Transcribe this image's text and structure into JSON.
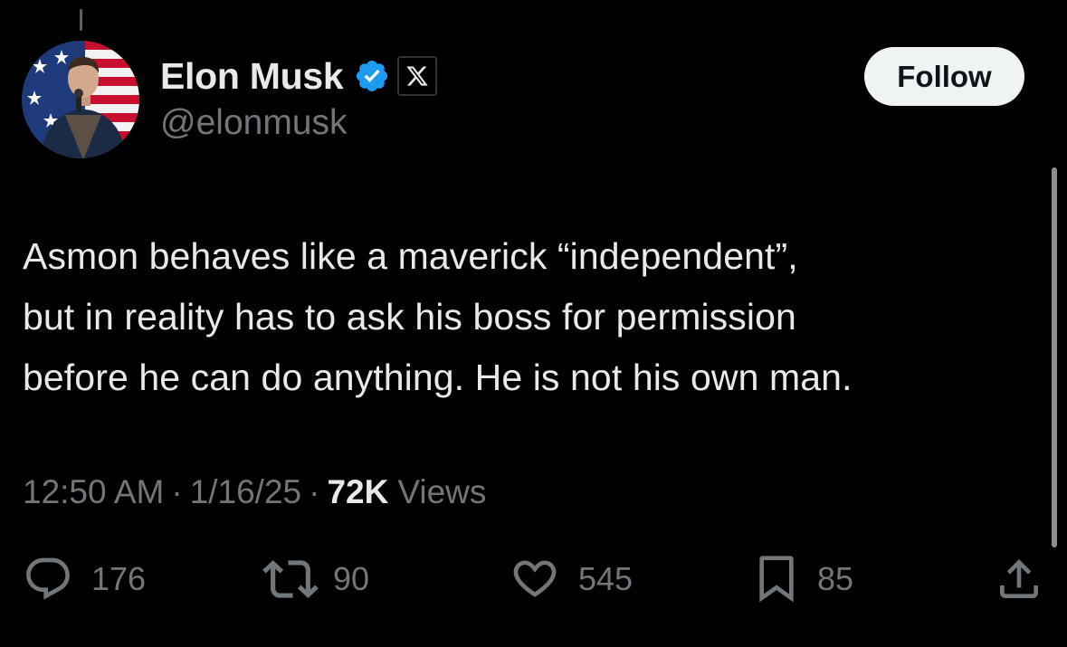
{
  "author": {
    "display_name": "Elon Musk",
    "handle": "@elonmusk",
    "verified_icon": "verified-badge-icon",
    "affiliate_icon": "x-logo-icon",
    "accent_color": "#1d9bf0"
  },
  "follow_button": {
    "label": "Follow"
  },
  "tweet": {
    "text": "Asmon behaves like a maverick “independent”,\nbut in reality has to ask his boss for permission\nbefore he can do anything. He is not his own man."
  },
  "meta": {
    "time": "12:50 AM",
    "separator": "·",
    "date": "1/16/25",
    "views_count": "72K",
    "views_label": "Views"
  },
  "actions": {
    "replies": {
      "icon": "reply-icon",
      "count": "176"
    },
    "reposts": {
      "icon": "repost-icon",
      "count": "90"
    },
    "likes": {
      "icon": "heart-icon",
      "count": "545"
    },
    "bookmarks": {
      "icon": "bookmark-icon",
      "count": "85"
    },
    "share": {
      "icon": "share-icon"
    }
  },
  "colors": {
    "background": "#000000",
    "primary_text": "#e7e9ea",
    "secondary_text": "#71767b",
    "follow_bg": "#eff3f4"
  }
}
